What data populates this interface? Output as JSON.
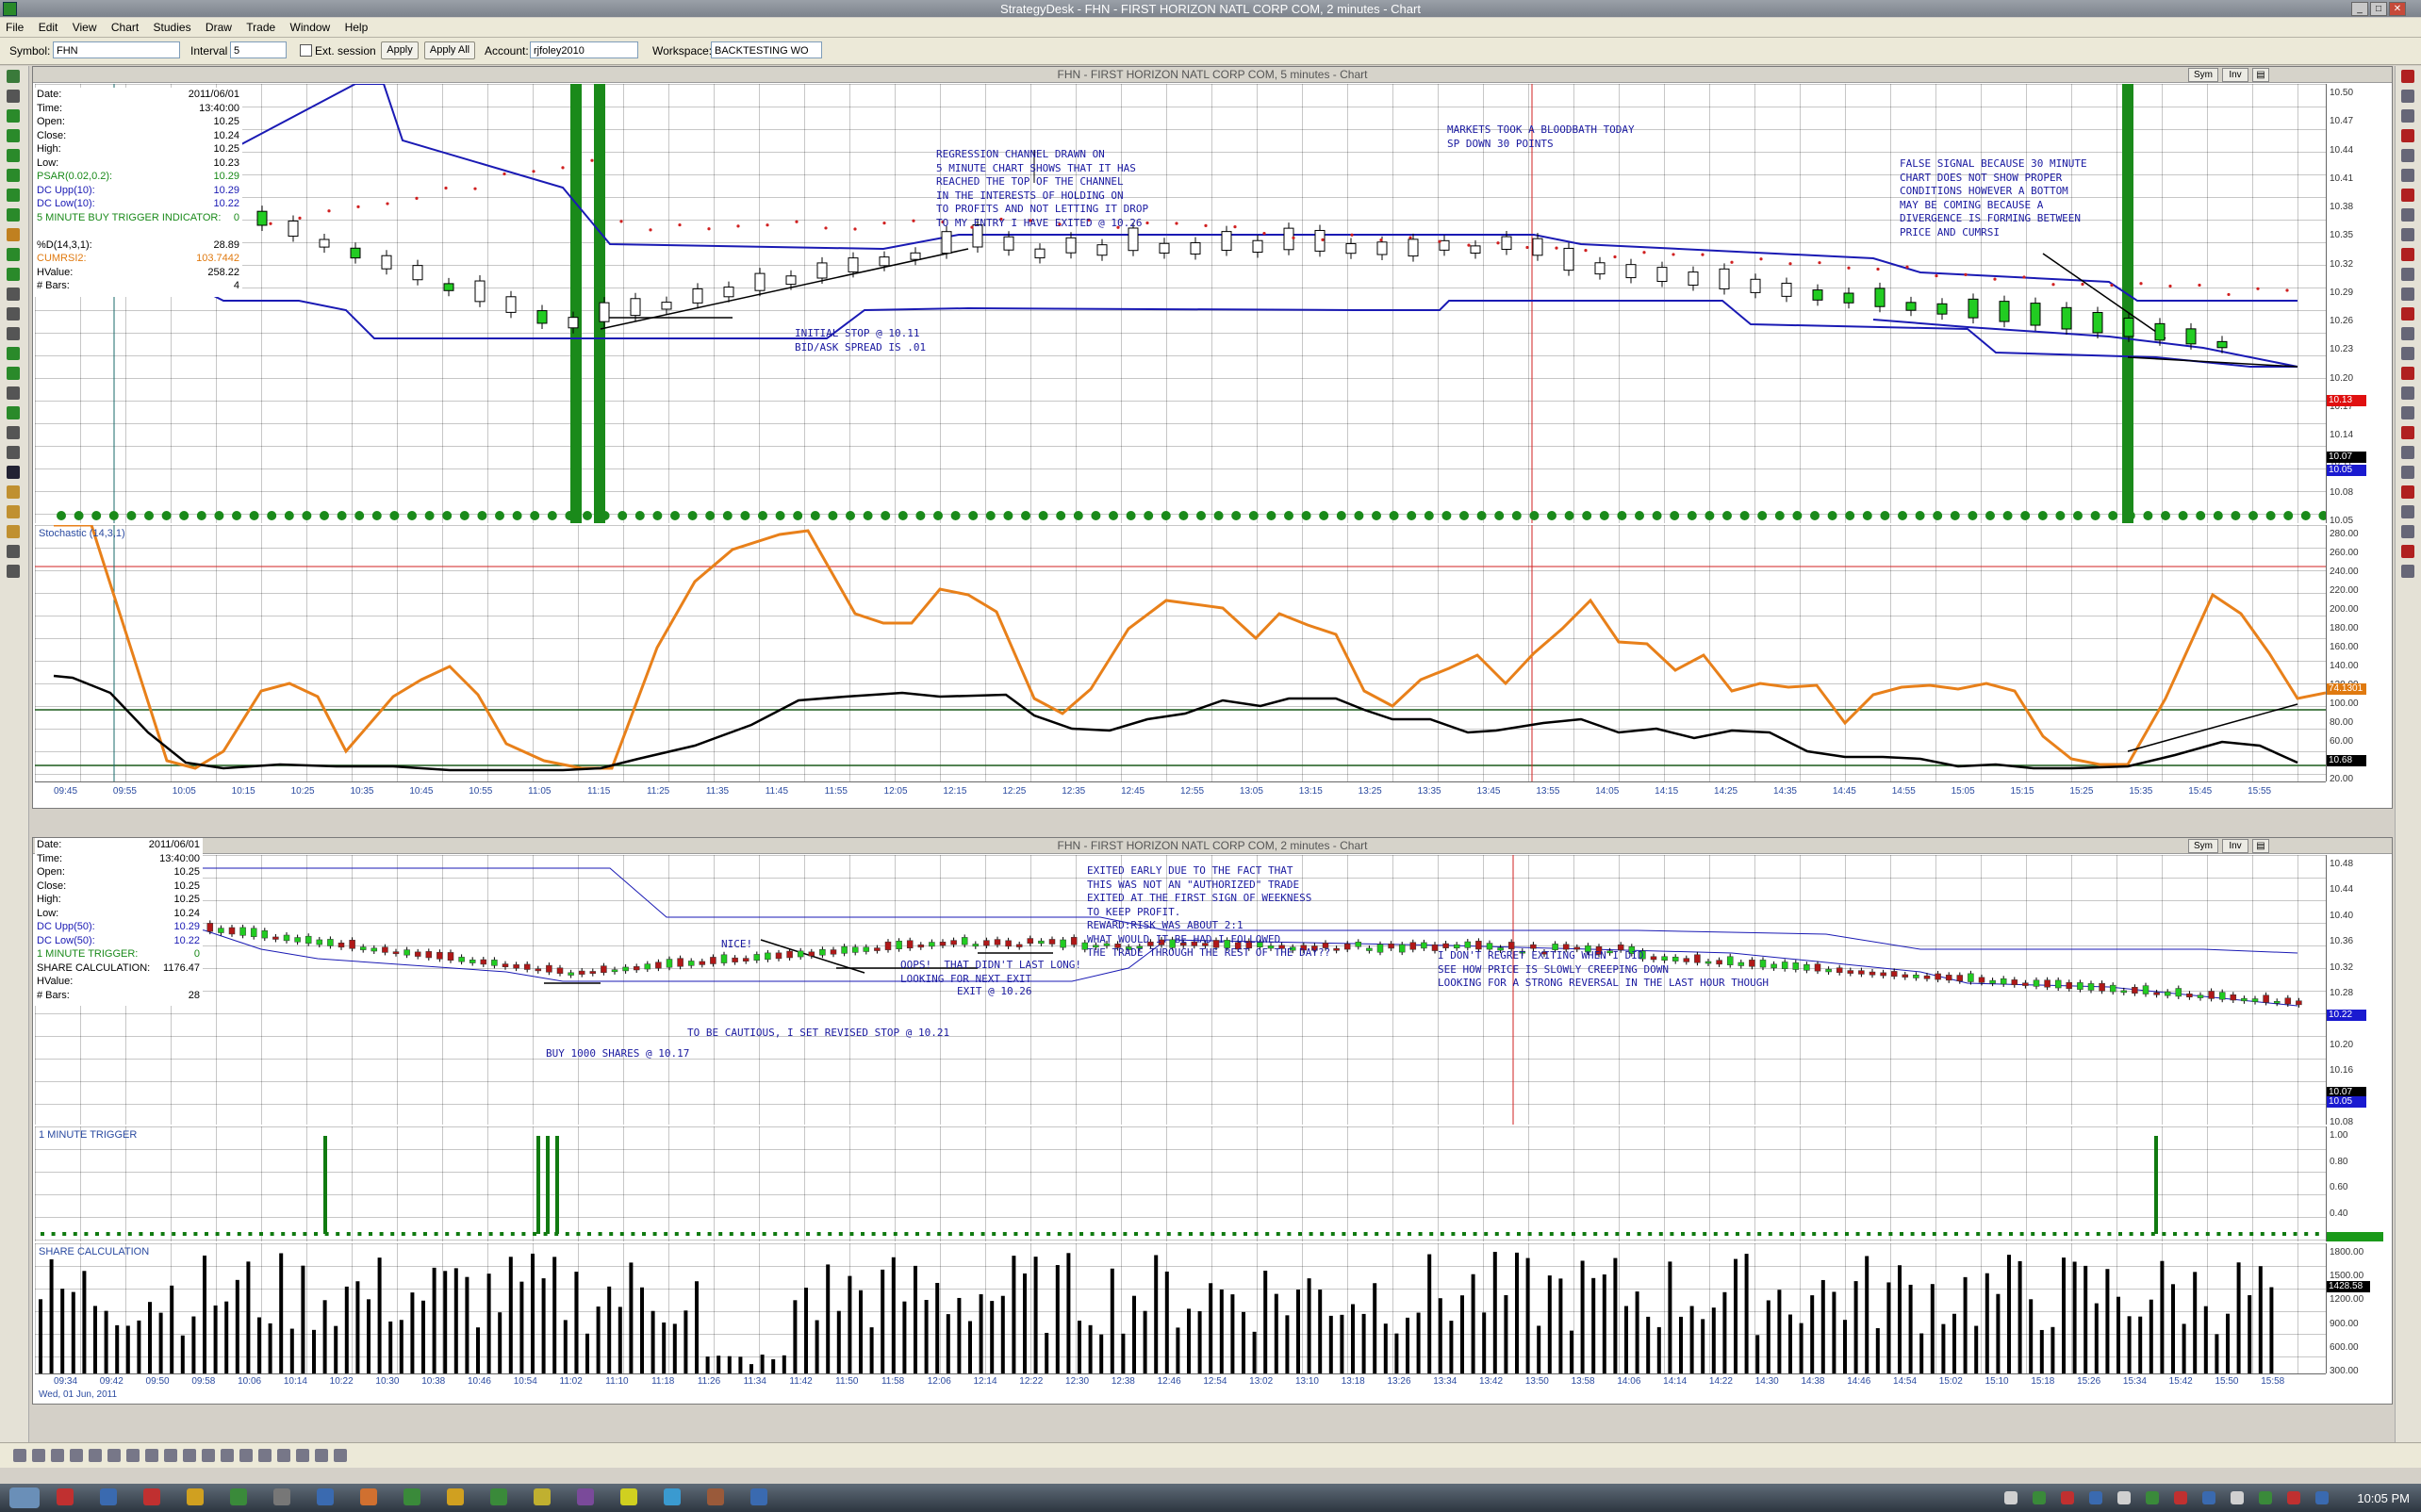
{
  "window": {
    "title": "StrategyDesk - FHN - FIRST HORIZON NATL CORP COM, 2 minutes - Chart"
  },
  "menu": [
    "File",
    "Edit",
    "View",
    "Chart",
    "Studies",
    "Draw",
    "Trade",
    "Window",
    "Help"
  ],
  "toolbar": {
    "symbol_label": "Symbol:",
    "symbol_value": "FHN",
    "interval_label": "Interval",
    "interval_value": "5",
    "ext_session_label": "Ext. session",
    "apply_label": "Apply",
    "apply_all_label": "Apply All",
    "account_label": "Account:",
    "account_value": "rjfoley2010",
    "workspace_label": "Workspace:",
    "workspace_value": "BACKTESTING WO"
  },
  "chart5": {
    "title": "FHN - FIRST HORIZON NATL CORP COM, 5 minutes - Chart",
    "sym_btn": "Sym",
    "inv_btn": "Inv",
    "data_panel": [
      {
        "k": "Date:",
        "v": "2011/06/01"
      },
      {
        "k": "Time:",
        "v": "13:40:00"
      },
      {
        "k": "Open:",
        "v": "10.25"
      },
      {
        "k": "Close:",
        "v": "10.24"
      },
      {
        "k": "High:",
        "v": "10.25"
      },
      {
        "k": "Low:",
        "v": "10.23"
      },
      {
        "k": "PSAR(0.02,0.2):",
        "v": "10.29"
      },
      {
        "k": "DC Upp(10):",
        "v": "10.29"
      },
      {
        "k": "DC Low(10):",
        "v": "10.22"
      },
      {
        "k": "5 MINUTE BUY TRIGGER INDICATOR:",
        "v": "0"
      },
      {
        "k": "",
        "v": ""
      },
      {
        "k": "%D(14,3,1):",
        "v": "28.89"
      },
      {
        "k": "CUMRSI2:",
        "v": "103.7442"
      },
      {
        "k": "HValue:",
        "v": "258.22"
      },
      {
        "k": "# Bars:",
        "v": "4"
      }
    ],
    "price_ticks": [
      "10.50",
      "10.47",
      "10.44",
      "10.41",
      "10.38",
      "10.35",
      "10.32",
      "10.29",
      "10.26",
      "10.23",
      "10.20",
      "10.17",
      "10.14",
      "10.11",
      "10.08",
      "10.05"
    ],
    "price_badges": [
      {
        "v": "10.13",
        "color": "#e01010"
      },
      {
        "v": "10.07",
        "color": "#000000"
      },
      {
        "v": "10.05",
        "color": "#1a1ad0"
      }
    ],
    "stoch_label": "Stochastic (14,3,1)",
    "stoch_ticks": [
      "280.00",
      "260.00",
      "240.00",
      "220.00",
      "200.00",
      "180.00",
      "160.00",
      "140.00",
      "120.00",
      "100.00",
      "80.00",
      "60.00",
      "40.00",
      "20.00"
    ],
    "stoch_badges": [
      {
        "v": "74.1301",
        "color": "#e07a10"
      },
      {
        "v": "10.68",
        "color": "#000000"
      }
    ],
    "time_ticks": [
      "09:45",
      "09:55",
      "10:05",
      "10:15",
      "10:25",
      "10:35",
      "10:45",
      "10:55",
      "11:05",
      "11:15",
      "11:25",
      "11:35",
      "11:45",
      "11:55",
      "12:05",
      "12:15",
      "12:25",
      "12:35",
      "12:45",
      "12:55",
      "13:05",
      "13:15",
      "13:25",
      "13:35",
      "13:45",
      "13:55",
      "14:05",
      "14:15",
      "14:25",
      "14:35",
      "14:45",
      "14:55",
      "15:05",
      "15:15",
      "15:25",
      "15:35",
      "15:45",
      "15:55"
    ],
    "annotations": [
      {
        "id": "regression",
        "text": "REGRESSION CHANNEL DRAWN ON\n5 MINUTE CHART SHOWS THAT IT HAS\nREACHED THE TOP OF THE CHANNEL\nIN THE INTERESTS OF HOLDING ON\nTO PROFITS AND NOT LETTING IT DROP\nTO MY ENTRY I HAVE EXITED @ 10.26"
      },
      {
        "id": "markets",
        "text": "MARKETS TOOK A BLOODBATH TODAY\nSP DOWN 30 POINTS"
      },
      {
        "id": "false_signal",
        "text": "FALSE SIGNAL BECAUSE 30 MINUTE\nCHART DOES NOT SHOW PROPER\nCONDITIONS HOWEVER A BOTTOM\nMAY BE COMING BECAUSE A\nDIVERGENCE IS FORMING BETWEEN\nPRICE AND CUMRSI"
      },
      {
        "id": "initial_stop",
        "text": "INITIAL STOP @ 10.11\nBID/ASK SPREAD IS .01"
      }
    ]
  },
  "chart2": {
    "title": "FHN - FIRST HORIZON NATL CORP COM, 2 minutes - Chart",
    "sym_btn": "Sym",
    "inv_btn": "Inv",
    "data_panel": [
      {
        "k": "Date:",
        "v": "2011/06/01"
      },
      {
        "k": "Time:",
        "v": "13:40:00"
      },
      {
        "k": "Open:",
        "v": "10.25"
      },
      {
        "k": "Close:",
        "v": "10.25"
      },
      {
        "k": "High:",
        "v": "10.25"
      },
      {
        "k": "Low:",
        "v": "10.24"
      },
      {
        "k": "DC Upp(50):",
        "v": "10.29"
      },
      {
        "k": "DC Low(50):",
        "v": "10.22"
      },
      {
        "k": "1 MINUTE TRIGGER:",
        "v": "0"
      },
      {
        "k": "SHARE CALCULATION:",
        "v": "1176.47"
      },
      {
        "k": "HValue:",
        "v": ""
      },
      {
        "k": "# Bars:",
        "v": "28"
      }
    ],
    "price_ticks": [
      "10.48",
      "10.44",
      "10.40",
      "10.36",
      "10.32",
      "10.28",
      "10.24",
      "10.20",
      "10.16",
      "10.12",
      "10.08"
    ],
    "price_badges": [
      {
        "v": "10.22",
        "color": "#1a1ad0"
      },
      {
        "v": "10.07",
        "color": "#000000"
      },
      {
        "v": "10.05",
        "color": "#1a1ad0"
      }
    ],
    "trigger_label": "1 MINUTE TRIGGER",
    "trigger_ticks": [
      "1.00",
      "0.80",
      "0.60",
      "0.40",
      "0.20"
    ],
    "share_label": "SHARE CALCULATION",
    "share_ticks": [
      "1800.00",
      "1500.00",
      "1200.00",
      "900.00",
      "600.00",
      "300.00"
    ],
    "share_badge": "1428.58",
    "date_label": "Wed, 01 Jun, 2011",
    "time_ticks": [
      "09:34",
      "09:42",
      "09:50",
      "09:58",
      "10:06",
      "10:14",
      "10:22",
      "10:30",
      "10:38",
      "10:46",
      "10:54",
      "11:02",
      "11:10",
      "11:18",
      "11:26",
      "11:34",
      "11:42",
      "11:50",
      "11:58",
      "12:06",
      "12:14",
      "12:22",
      "12:30",
      "12:38",
      "12:46",
      "12:54",
      "13:02",
      "13:10",
      "13:18",
      "13:26",
      "13:34",
      "13:42",
      "13:50",
      "13:58",
      "14:06",
      "14:14",
      "14:22",
      "14:30",
      "14:38",
      "14:46",
      "14:54",
      "15:02",
      "15:10",
      "15:18",
      "15:26",
      "15:34",
      "15:42",
      "15:50",
      "15:58"
    ],
    "annotations": [
      {
        "id": "exited_early",
        "text": "EXITED EARLY DUE TO THE FACT THAT\nTHIS WAS NOT AN \"AUTHORIZED\" TRADE\nEXITED AT THE FIRST SIGN OF WEEKNESS\nTO KEEP PROFIT.\nREWARD:RISK WAS ABOUT 2:1\nWHAT WOULD IT BE HAD I FOLLOWED\nTHE TRADE THROUGH THE REST OF THE DAY??"
      },
      {
        "id": "nice",
        "text": "NICE!"
      },
      {
        "id": "oops",
        "text": "OOPS!  THAT DIDN'T LAST LONG!\nLOOKING FOR NEXT EXIT"
      },
      {
        "id": "exit",
        "text": "EXIT @ 10.26"
      },
      {
        "id": "cautious",
        "text": "TO BE CAUTIOUS, I SET REVISED STOP @ 10.21"
      },
      {
        "id": "buy",
        "text": "BUY 1000 SHARES @ 10.17"
      },
      {
        "id": "no_regret",
        "text": "I DON'T REGRET EXITING WHEN I DID\nSEE HOW PRICE IS SLOWLY CREEPING DOWN\nLOOKING FOR A STRONG REVERSAL IN THE LAST HOUR THOUGH"
      }
    ]
  },
  "taskbar": {
    "clock": "10:05 PM"
  },
  "colors": {
    "up_candle": "#22cc22",
    "down_candle": "#b01818",
    "channel": "#1a1ab4",
    "stoch_k": "#e8801a",
    "stoch_d": "#000000",
    "trigger": "#107a10"
  }
}
